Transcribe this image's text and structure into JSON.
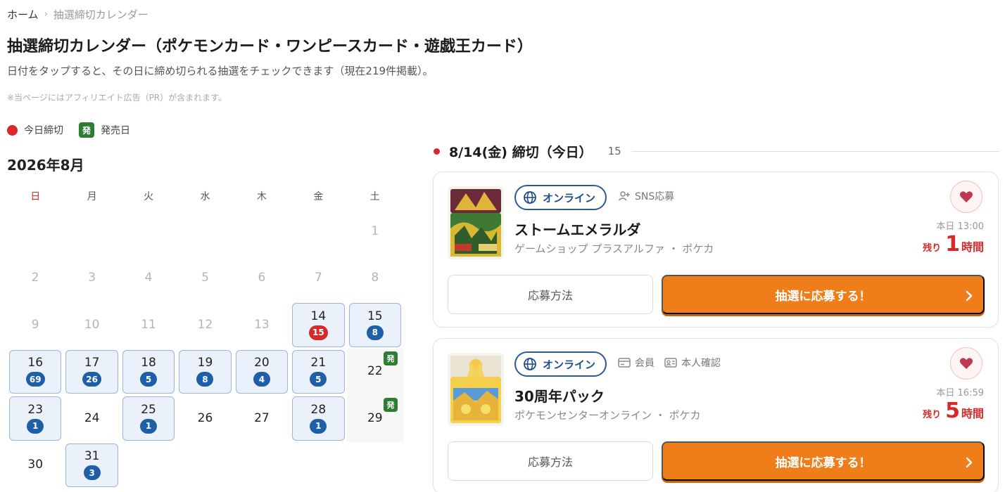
{
  "breadcrumb": {
    "home": "ホーム",
    "separator": "›",
    "current": "抽選締切カレンダー"
  },
  "page_title": "抽選締切カレンダー（ポケモンカード・ワンピースカード・遊戯王カード）",
  "subtitle": "日付をタップすると、その日に締め切られる抽選をチェックできます（現在219件掲載）。",
  "disclaimer": "※当ページにはアフィリエイト広告（PR）が含まれます。",
  "legend": {
    "today_label": "今日締切",
    "release_badge": "発",
    "release_label": "発売日"
  },
  "calendar": {
    "month_title": "2026年8月",
    "weekdays": [
      "日",
      "月",
      "火",
      "水",
      "木",
      "金",
      "土"
    ],
    "days": [
      {
        "n": "",
        "t": "blank"
      },
      {
        "n": "",
        "t": "blank"
      },
      {
        "n": "",
        "t": "blank"
      },
      {
        "n": "",
        "t": "blank"
      },
      {
        "n": "",
        "t": "blank"
      },
      {
        "n": "",
        "t": "blank"
      },
      {
        "n": "1",
        "t": "faded"
      },
      {
        "n": "2",
        "t": "faded"
      },
      {
        "n": "3",
        "t": "faded"
      },
      {
        "n": "4",
        "t": "faded"
      },
      {
        "n": "5",
        "t": "faded"
      },
      {
        "n": "6",
        "t": "faded"
      },
      {
        "n": "7",
        "t": "faded"
      },
      {
        "n": "8",
        "t": "faded"
      },
      {
        "n": "9",
        "t": "faded"
      },
      {
        "n": "10",
        "t": "faded"
      },
      {
        "n": "11",
        "t": "faded"
      },
      {
        "n": "12",
        "t": "faded"
      },
      {
        "n": "13",
        "t": "faded"
      },
      {
        "n": "14",
        "t": "today",
        "count": "15"
      },
      {
        "n": "15",
        "t": "active",
        "count": "8"
      },
      {
        "n": "16",
        "t": "active",
        "count": "69"
      },
      {
        "n": "17",
        "t": "active",
        "count": "26"
      },
      {
        "n": "18",
        "t": "active",
        "count": "5"
      },
      {
        "n": "19",
        "t": "active",
        "count": "8"
      },
      {
        "n": "20",
        "t": "active",
        "count": "4"
      },
      {
        "n": "21",
        "t": "active",
        "count": "5"
      },
      {
        "n": "22",
        "t": "plain",
        "release": "発"
      },
      {
        "n": "23",
        "t": "active",
        "count": "1"
      },
      {
        "n": "24",
        "t": "plain"
      },
      {
        "n": "25",
        "t": "active",
        "count": "1"
      },
      {
        "n": "26",
        "t": "plain"
      },
      {
        "n": "27",
        "t": "plain"
      },
      {
        "n": "28",
        "t": "active",
        "count": "1"
      },
      {
        "n": "29",
        "t": "plain",
        "release": "発"
      },
      {
        "n": "30",
        "t": "plain"
      },
      {
        "n": "31",
        "t": "active",
        "count": "3"
      }
    ]
  },
  "selected_day": {
    "label": "8/14(金) 締切（今日）",
    "count": "15"
  },
  "cards": [
    {
      "channel": "オンライン",
      "tags": [
        {
          "icon": "person-plus-icon",
          "label": "SNS応募"
        }
      ],
      "product": "ストームエメラルダ",
      "shop": "ゲームショップ プラスアルファ ・ ポケカ",
      "deadline": "本日 13:00",
      "remain_prefix": "残り",
      "remain_num": "1",
      "remain_unit": "時間",
      "method_label": "応募方法",
      "apply_label": "抽選に応募する！",
      "accent": "#ee7d1a"
    },
    {
      "channel": "オンライン",
      "tags": [
        {
          "icon": "card-icon",
          "label": "会員"
        },
        {
          "icon": "id-card-icon",
          "label": "本人確認"
        }
      ],
      "product": "30周年パック",
      "shop": "ポケモンセンターオンライン ・ ポケカ",
      "deadline": "本日 16:59",
      "remain_prefix": "残り",
      "remain_num": "5",
      "remain_unit": "時間",
      "method_label": "応募方法",
      "apply_label": "抽選に応募する！",
      "accent": "#ee7d1a"
    }
  ]
}
